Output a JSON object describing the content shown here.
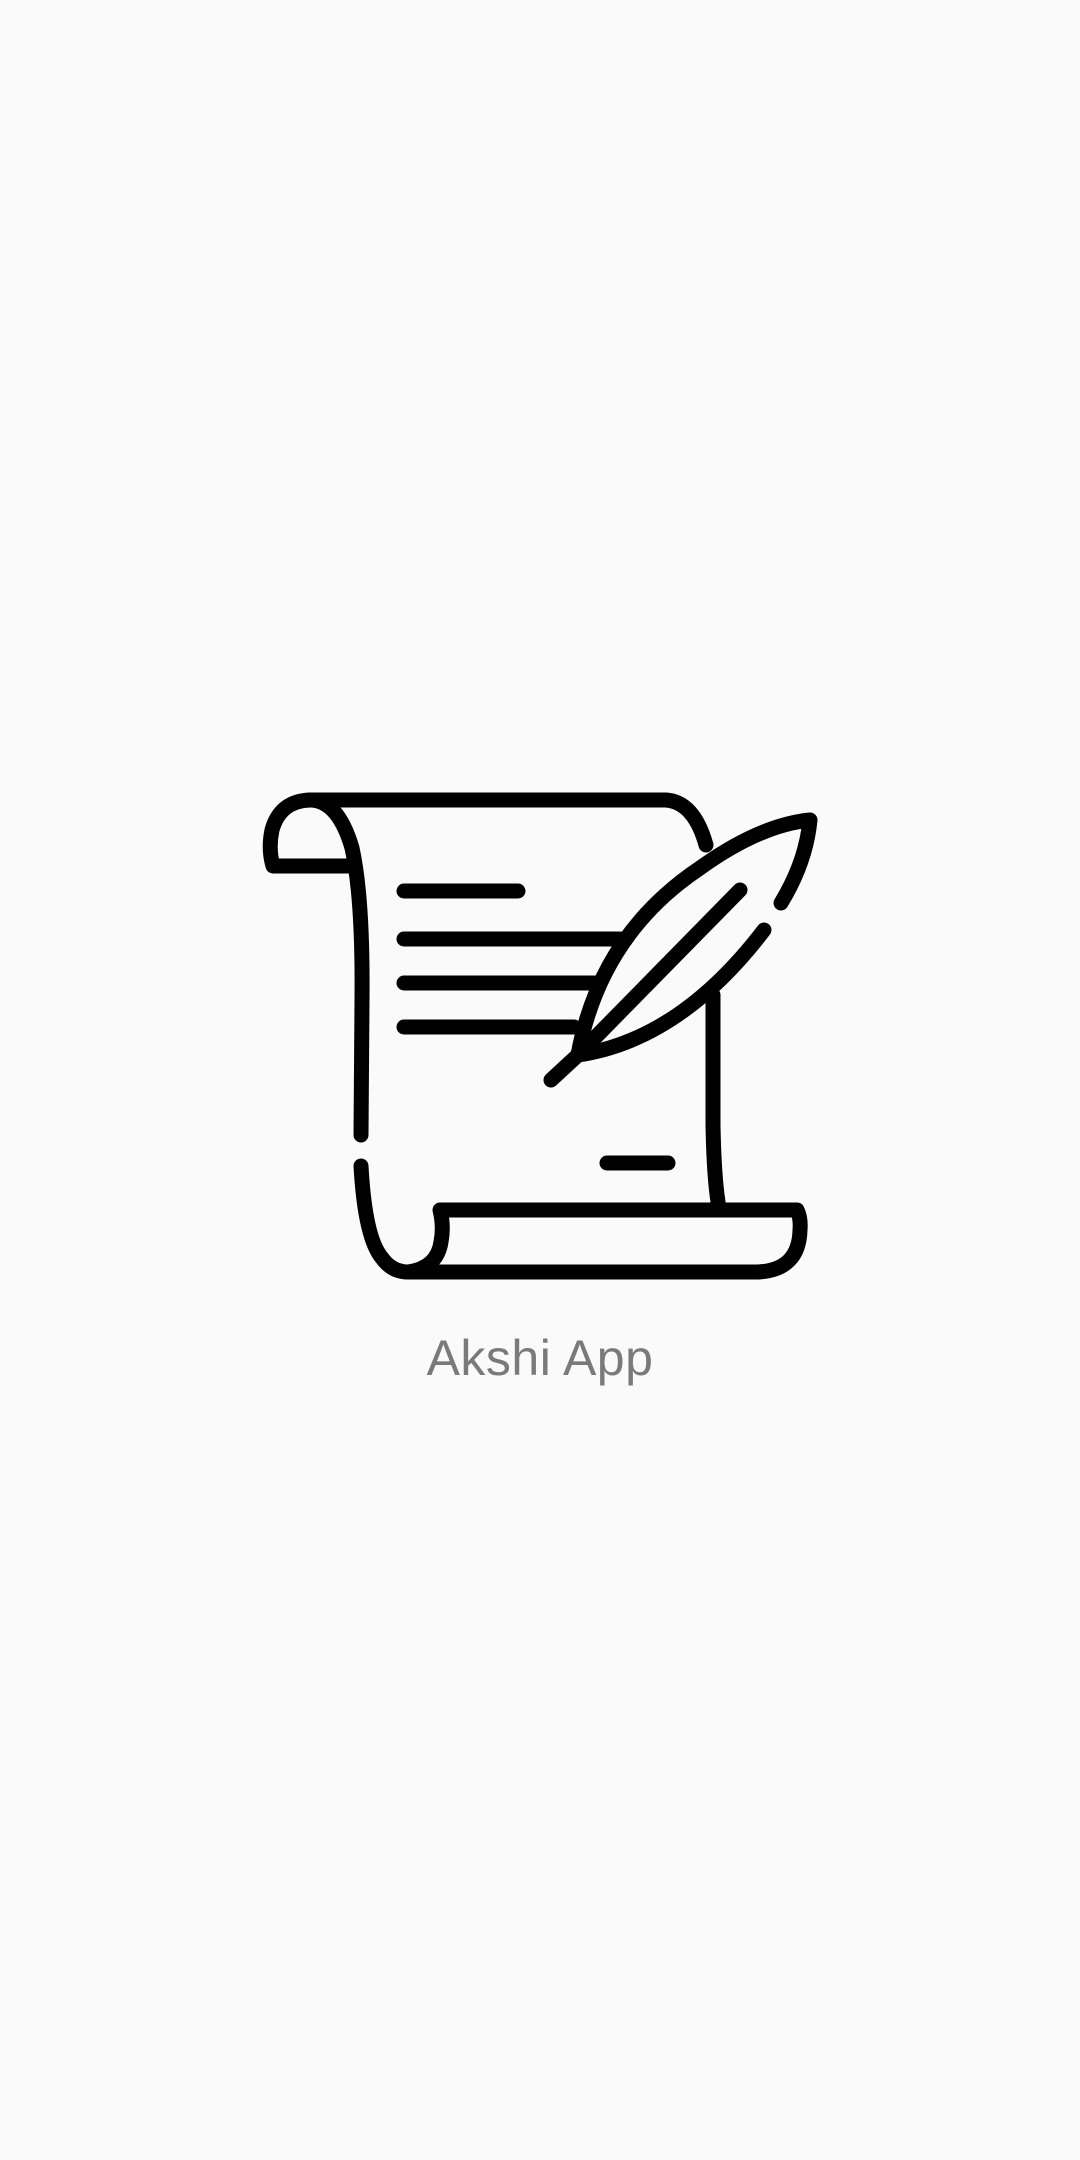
{
  "splash": {
    "logo_icon": "scroll-with-quill-icon",
    "app_name": "Akshi App"
  },
  "colors": {
    "background": "#fafafa",
    "icon_stroke": "#000000",
    "app_name_text": "#7a7a7a"
  }
}
